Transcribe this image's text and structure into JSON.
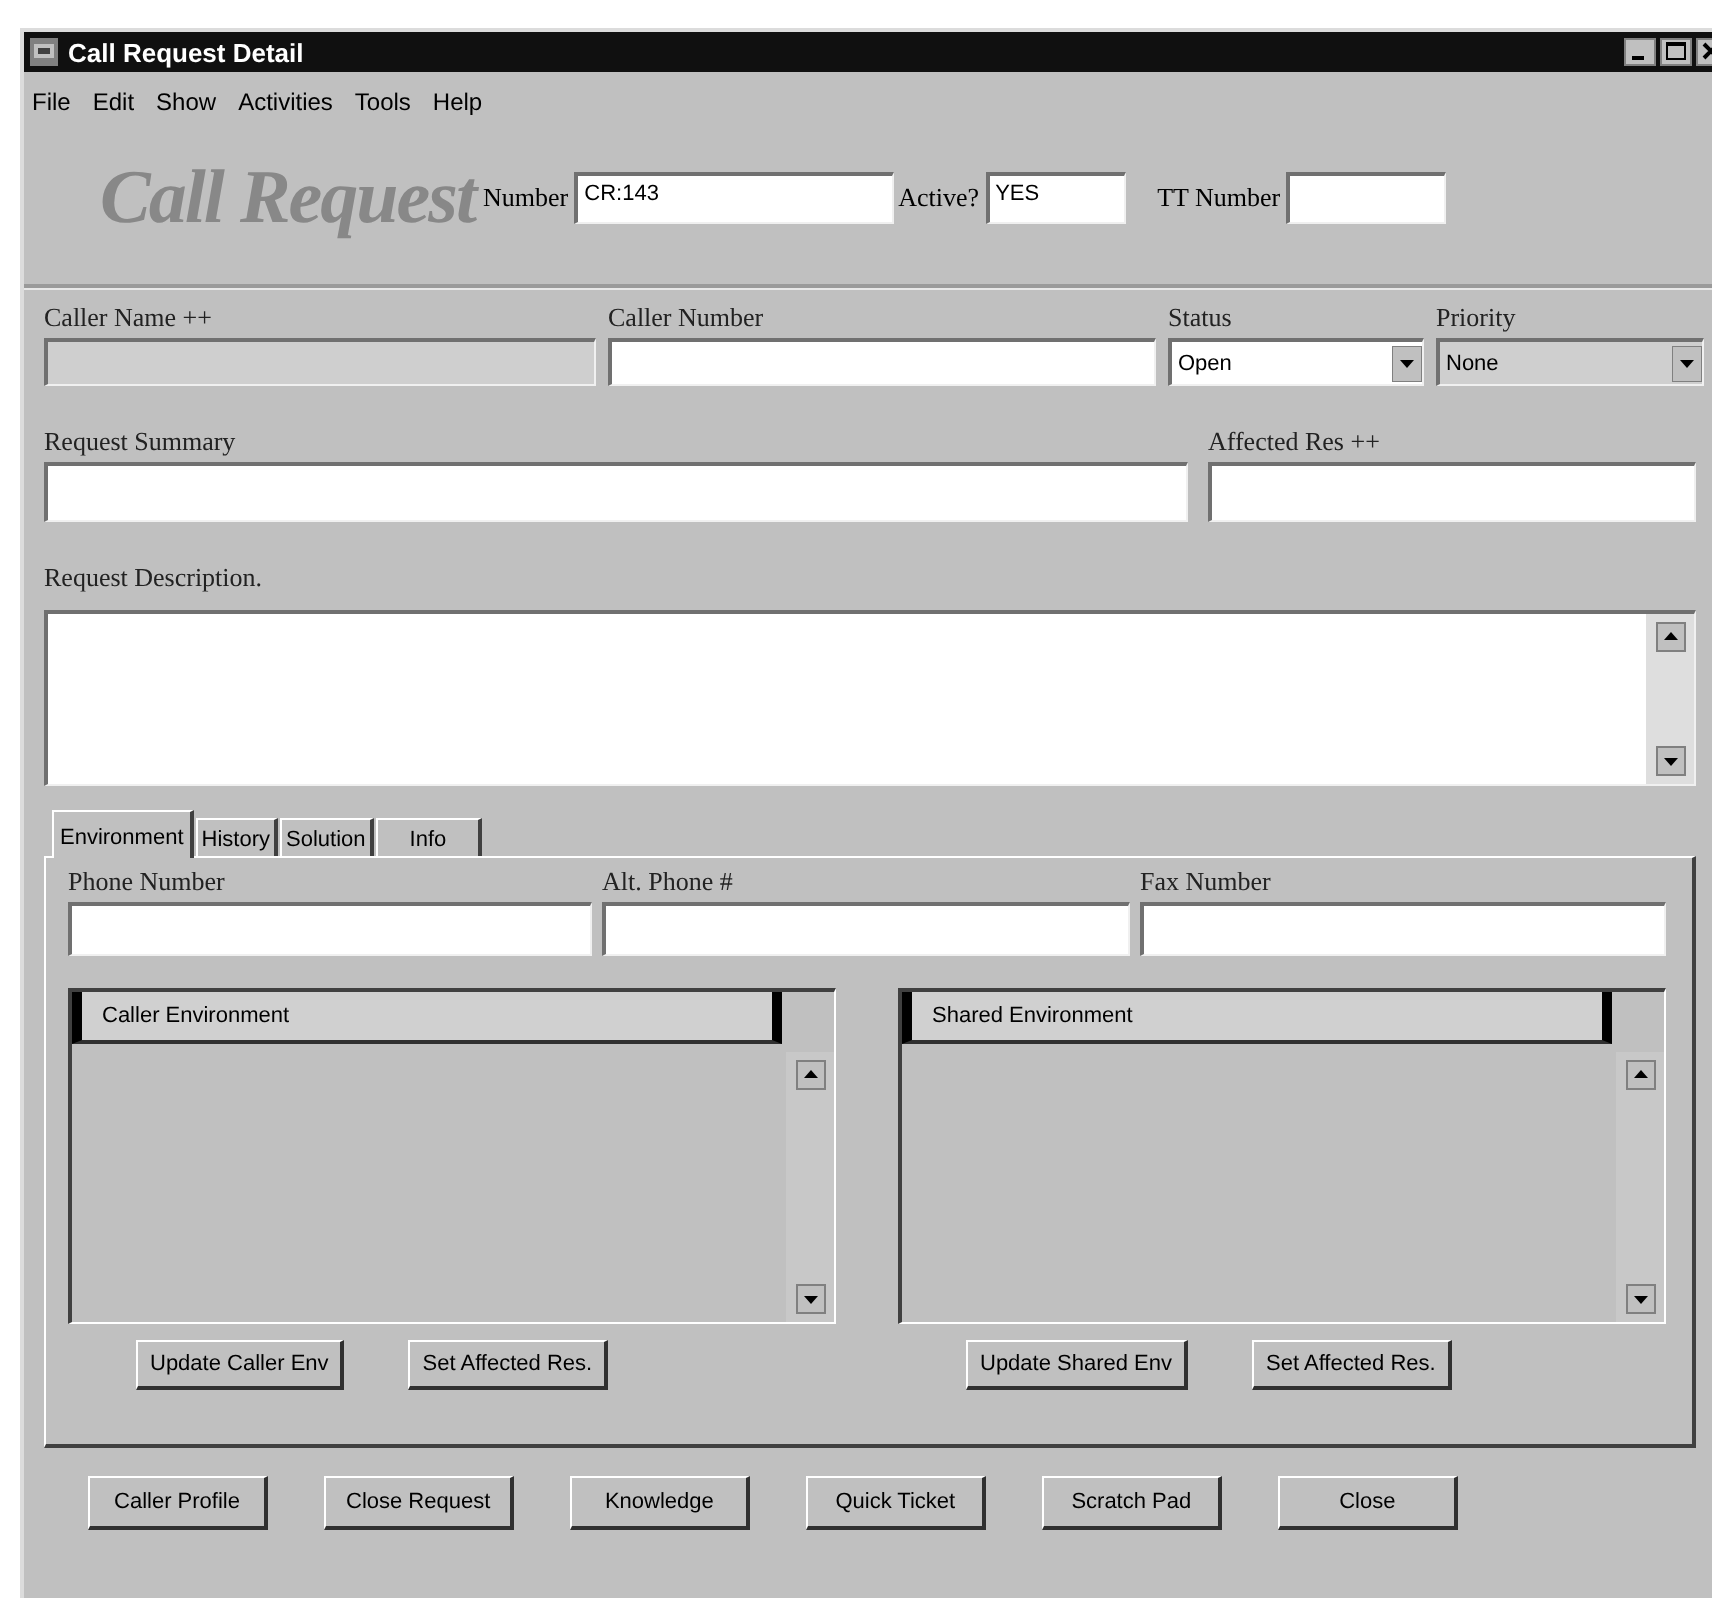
{
  "window": {
    "title": "Call Request Detail"
  },
  "menu": [
    "File",
    "Edit",
    "Show",
    "Activities",
    "Tools",
    "Help"
  ],
  "header": {
    "logo": "Call Request",
    "fields": [
      {
        "label": "Number",
        "value": "CR:143"
      },
      {
        "label": "Active?",
        "value": "YES"
      },
      {
        "label": "TT Number"
      }
    ]
  },
  "fields_row_1": [
    {
      "label": "Caller Name ++",
      "kind": "text",
      "disabled": true
    },
    {
      "label": "Caller Number",
      "kind": "text",
      "disabled": false
    },
    {
      "label": "Status",
      "kind": "dropdown",
      "value": "Open",
      "disabled": false
    },
    {
      "label": "Priority",
      "kind": "dropdown",
      "value": "None",
      "disabled": true
    }
  ],
  "fields_row_2": [
    {
      "label": "Request Summary",
      "kind": "text",
      "disabled": false
    },
    {
      "label": "Affected Res ++",
      "kind": "text",
      "disabled": false
    }
  ],
  "description": {
    "label": "Request Description."
  },
  "tabs": [
    {
      "label": "Environment",
      "selected": true
    },
    {
      "label": "History",
      "selected": false
    },
    {
      "label": "Solution",
      "selected": false
    },
    {
      "label": "Info",
      "selected": false
    }
  ],
  "tab_panel": {
    "fields": [
      {
        "label": "Phone Number"
      },
      {
        "label": "Alt. Phone #"
      },
      {
        "label": "Fax Number"
      }
    ],
    "environments": [
      {
        "header": "Caller Environment",
        "buttons": [
          "Update Caller Env",
          "Set Affected Res."
        ]
      },
      {
        "header": "Shared Environment",
        "buttons": [
          "Update Shared Env",
          "Set Affected Res."
        ]
      }
    ]
  },
  "buttons": [
    "Caller Profile",
    "Close Request",
    "Knowledge",
    "Quick Ticket",
    "Scratch Pad",
    "Close"
  ]
}
